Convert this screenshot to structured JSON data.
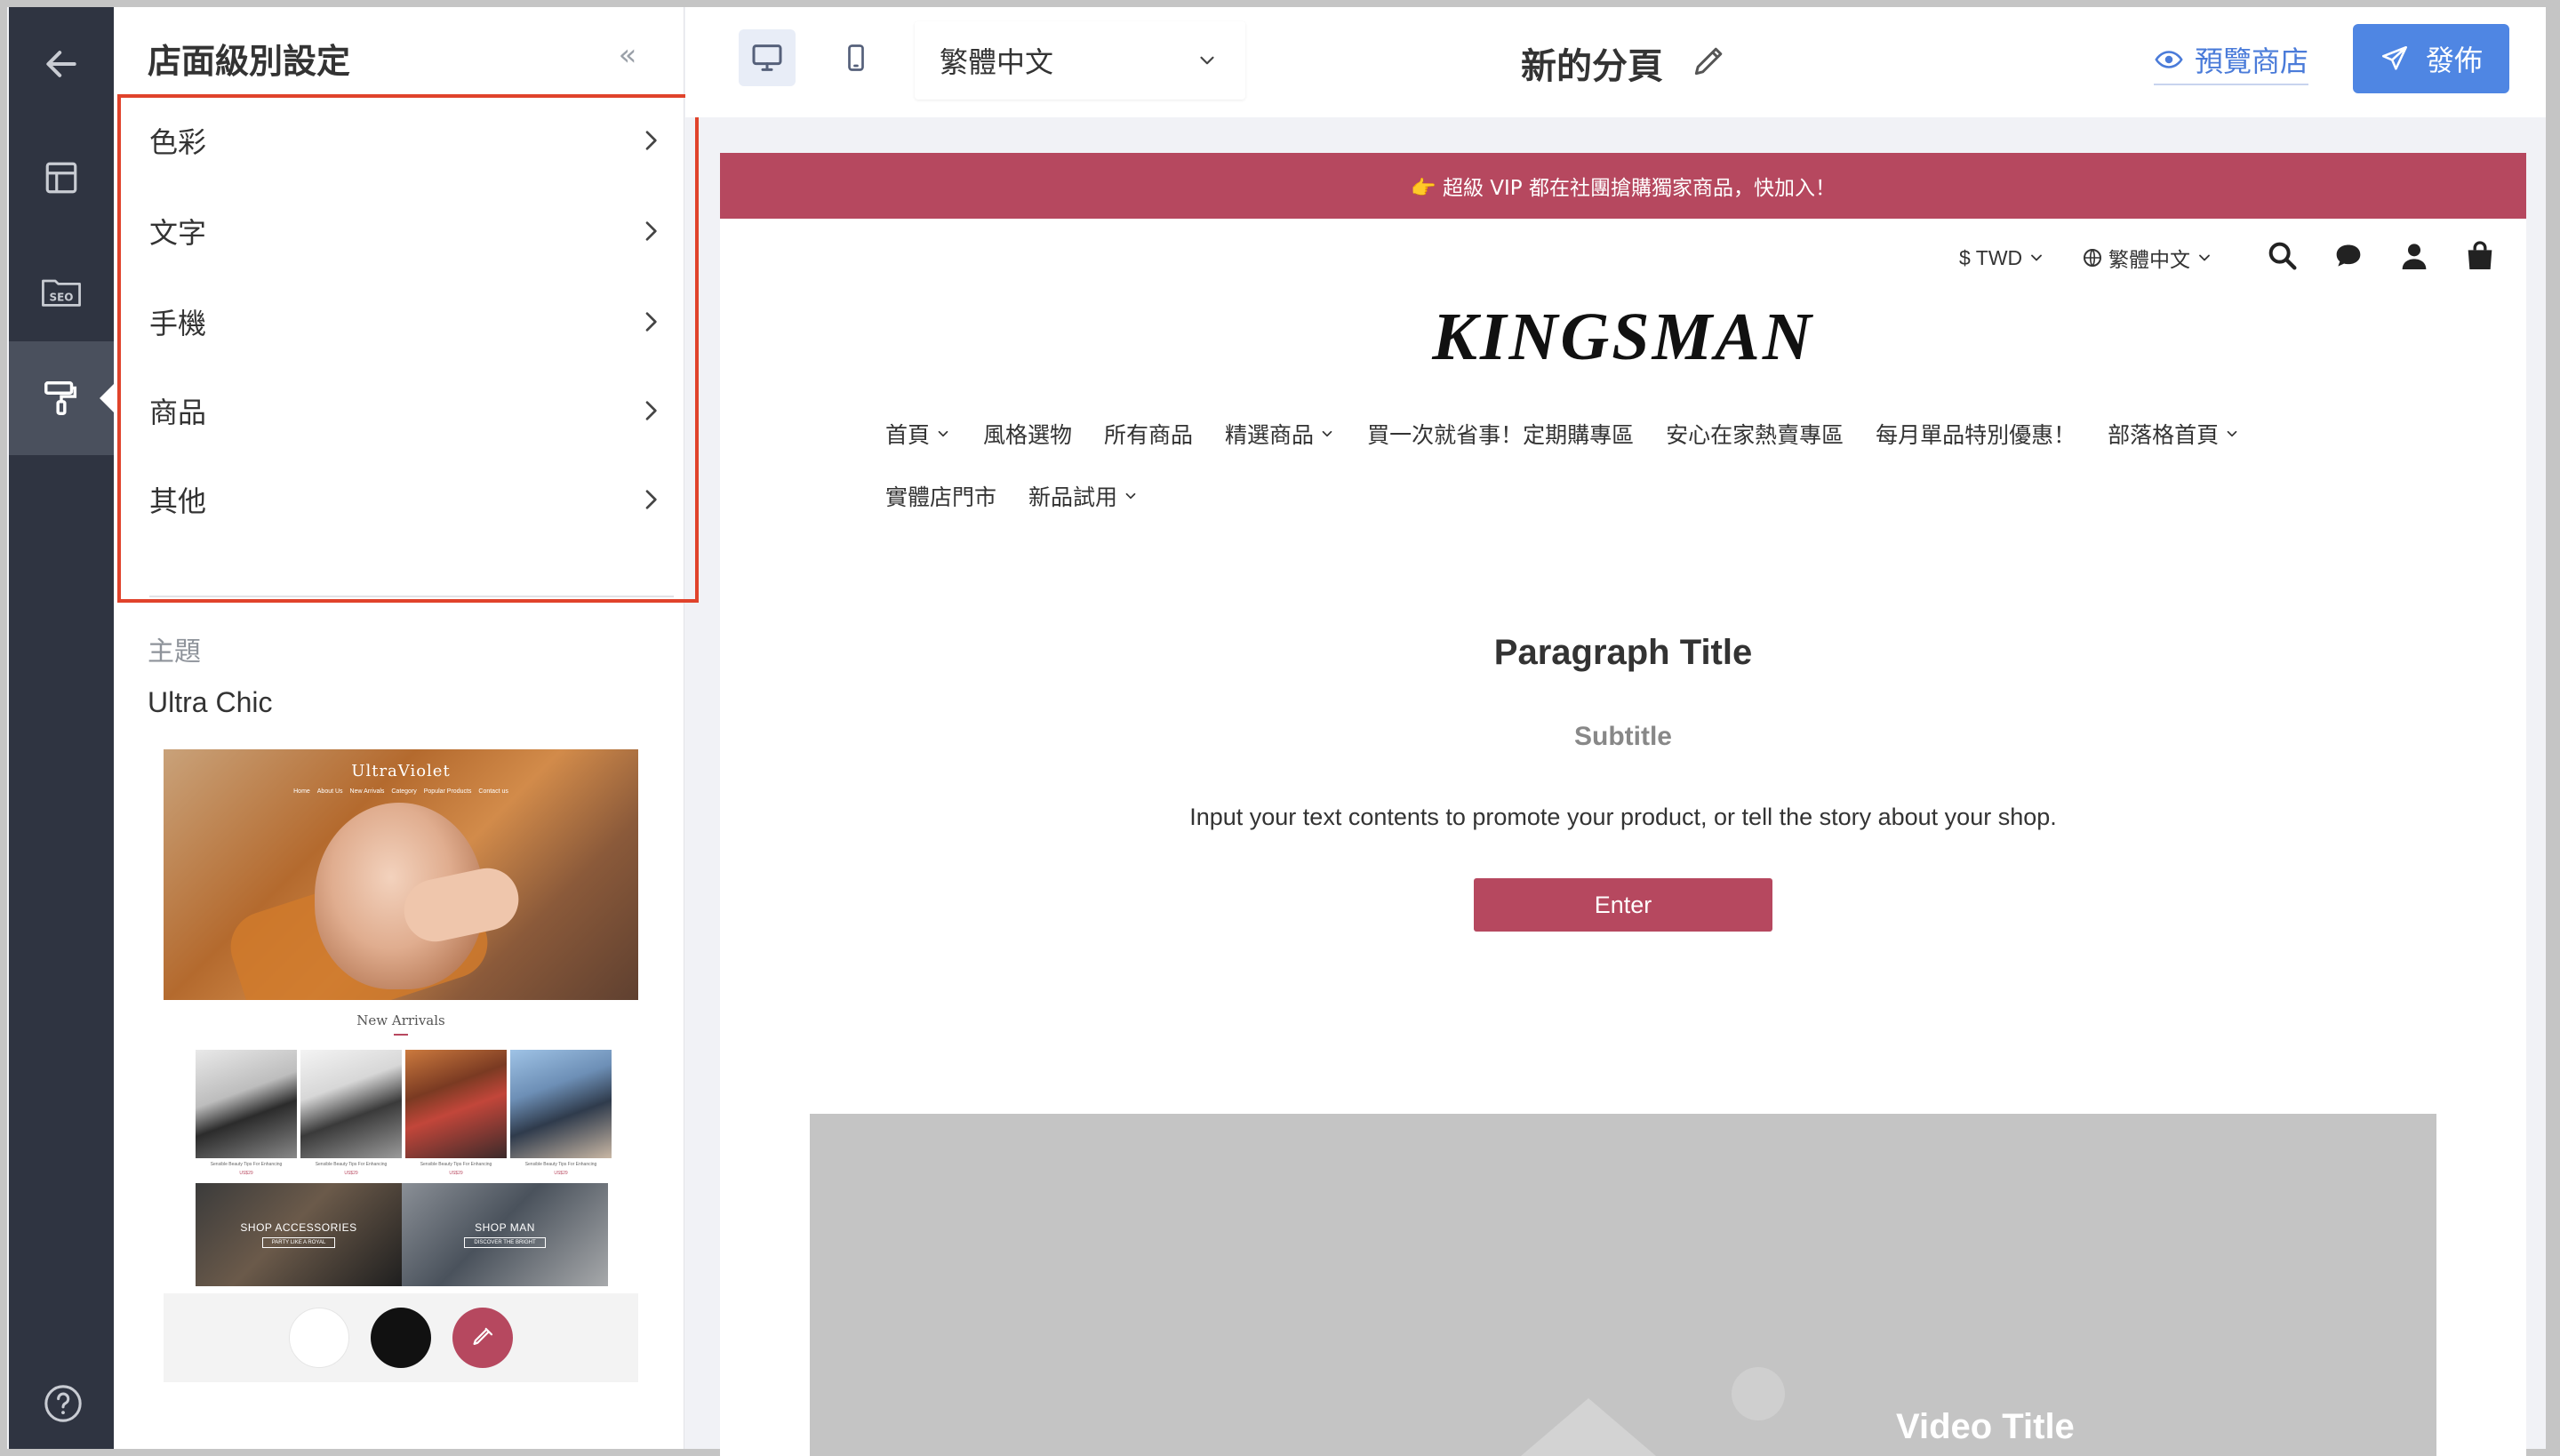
{
  "sidebar": {
    "title": "店面級別設定",
    "collapse_icon": "«",
    "menu": [
      {
        "label": "色彩"
      },
      {
        "label": "文字"
      },
      {
        "label": "手機"
      },
      {
        "label": "商品"
      },
      {
        "label": "其他"
      }
    ],
    "theme_section_label": "主題",
    "theme_name": "Ultra Chic",
    "theme_preview": {
      "logo": "UltraViolet",
      "nav": [
        "Home",
        "About Us",
        "New Arrivals",
        "Category",
        "Popular Products",
        "Contact us"
      ],
      "new_arrivals": "New Arrivals",
      "product_caption": "Sensible Beauty Tips For Enhancing",
      "product_price": "US$29",
      "banners": [
        {
          "title": "SHOP ACCESSORIES",
          "button": "PARTY LIKE A ROYAL"
        },
        {
          "title": "SHOP MAN",
          "button": "DISCOVER THE BRIGHT"
        }
      ],
      "swatches": [
        "#ffffff",
        "#111111",
        "#b6485f"
      ]
    }
  },
  "rail": {
    "icons": [
      "back-arrow-icon",
      "layout-icon",
      "seo-icon",
      "paint-roller-icon",
      "help-icon"
    ],
    "seo_label": "SEO"
  },
  "toolbar": {
    "language": "繁體中文",
    "page_name": "新的分頁",
    "preview_label": "預覽商店",
    "publish_label": "發佈"
  },
  "store": {
    "announcement": "👉 超級 VIP 都在社團搶購獨家商品，快加入！",
    "currency": "$ TWD",
    "language": "繁體中文",
    "brand": "KINGSMAN",
    "nav_row1": [
      {
        "label": "首頁",
        "dropdown": true
      },
      {
        "label": "風格選物",
        "dropdown": false
      },
      {
        "label": "所有商品",
        "dropdown": false
      },
      {
        "label": "精選商品",
        "dropdown": true
      },
      {
        "label": "買一次就省事！定期購專區",
        "dropdown": false
      },
      {
        "label": "安心在家熱賣專區",
        "dropdown": false
      },
      {
        "label": "每月單品特別優惠！",
        "dropdown": false
      },
      {
        "label": "部落格首頁",
        "dropdown": true
      }
    ],
    "nav_row2": [
      {
        "label": "實體店門市",
        "dropdown": false
      },
      {
        "label": "新品試用",
        "dropdown": true
      }
    ],
    "paragraph_title": "Paragraph Title",
    "subtitle": "Subtitle",
    "body": "Input your text contents to promote your product, or tell the story about your shop.",
    "button_label": "Enter",
    "video_title": "Video Title",
    "accent_color": "#b6485f"
  }
}
